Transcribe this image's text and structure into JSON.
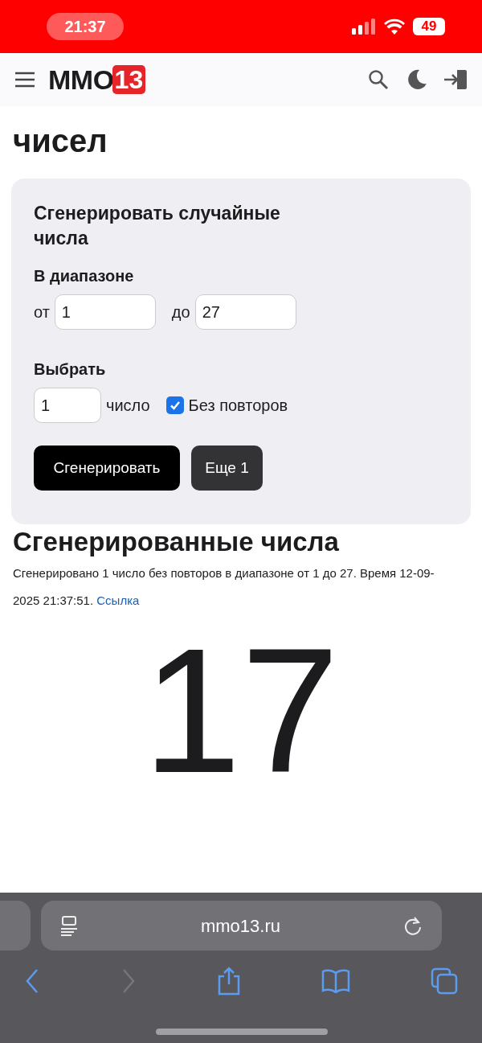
{
  "status_bar": {
    "time": "21:37",
    "battery": "49"
  },
  "header": {
    "logo_text": "ММО",
    "logo_badge": "13"
  },
  "page_title": "чисел",
  "form": {
    "title": "Сгенерировать случайные числа",
    "range_label": "В диапазоне",
    "from_label": "от",
    "from_value": "1",
    "to_label": "до",
    "to_value": "27",
    "pick_label": "Выбрать",
    "count_value": "1",
    "count_unit": "число",
    "no_repeat": {
      "label": "Без повторов",
      "checked": true
    },
    "buttons": [
      {
        "label": "Сгенерировать",
        "kind": "primary"
      },
      {
        "label": "Еще 1",
        "kind": "secondary"
      }
    ]
  },
  "result": {
    "title": "Сгенерированные числа",
    "description": "Сгенерировано 1 число без повторов в диапазоне от 1 до 27. Время 12-09-2025 21:37:51.",
    "link": "Ссылка",
    "number": "17"
  },
  "browser": {
    "url": "mmo13.ru"
  }
}
